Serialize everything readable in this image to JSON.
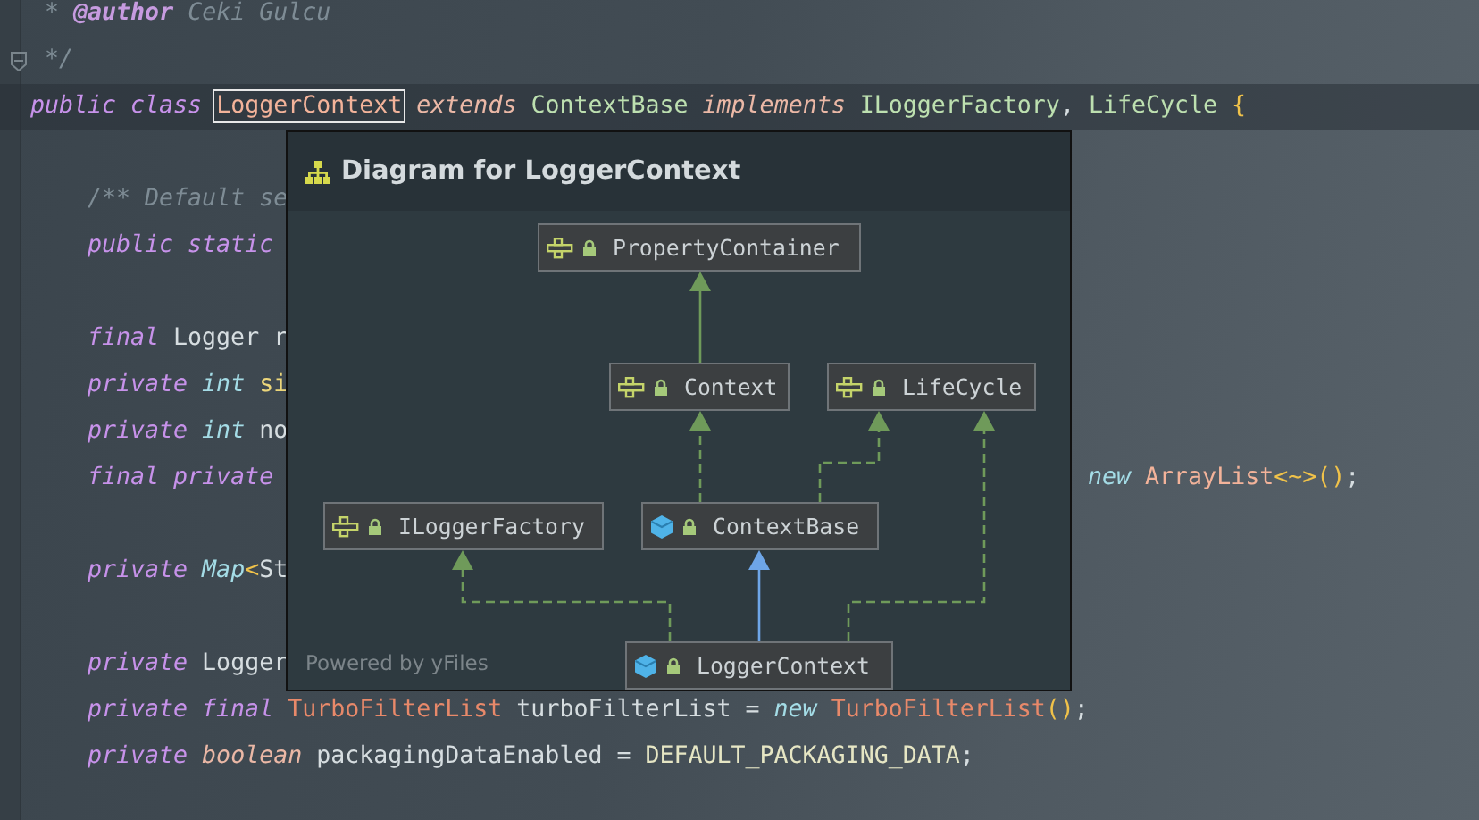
{
  "code": {
    "lines": [
      {
        "tokens": [
          {
            "kind": "comment",
            "text": " * "
          },
          {
            "kind": "doctag",
            "text": "@author"
          },
          {
            "kind": "comment",
            "text": " Ceki Gulcu"
          }
        ]
      },
      {
        "tokens": [
          {
            "kind": "comment",
            "text": " */"
          }
        ],
        "fold": true
      },
      {
        "current": true,
        "tokens": [
          {
            "kind": "keyword",
            "text": "public class "
          },
          {
            "kind": "class",
            "text": "LoggerContext",
            "highlighted": true
          },
          {
            "kind": "keyword2",
            "text": " extends "
          },
          {
            "kind": "type",
            "text": "ContextBase"
          },
          {
            "kind": "keyword2",
            "text": " implements "
          },
          {
            "kind": "type",
            "text": "ILoggerFactory"
          },
          {
            "kind": "plain",
            "text": ", "
          },
          {
            "kind": "type",
            "text": "LifeCycle"
          },
          {
            "kind": "brace",
            "text": " {"
          }
        ],
        "children": [
          {
            "blank": true
          },
          {
            "tokens": [
              {
                "kind": "comment",
                "text": "/** Default se"
              }
            ]
          },
          {
            "tokens": [
              {
                "kind": "keyword",
                "text": "public static"
              }
            ]
          },
          {
            "blank": true
          },
          {
            "tokens": [
              {
                "kind": "keyword",
                "text": "final"
              },
              {
                "kind": "plain",
                "text": " Logger r"
              }
            ]
          },
          {
            "tokens": [
              {
                "kind": "keyword",
                "text": "private"
              },
              {
                "kind": "keyword3",
                "text": " int"
              },
              {
                "kind": "field",
                "text": " si"
              }
            ]
          },
          {
            "tokens": [
              {
                "kind": "keyword",
                "text": "private"
              },
              {
                "kind": "keyword3",
                "text": " int"
              },
              {
                "kind": "plain",
                "text": " no"
              }
            ]
          },
          {
            "tokens": [
              {
                "kind": "keyword",
                "text": "final private"
              }
            ],
            "tail": [
              {
                "kind": "keyword3",
                "text": "new"
              },
              {
                "kind": "class",
                "text": " ArrayList"
              },
              {
                "kind": "brace",
                "text": "<~>()"
              },
              {
                "kind": "plain",
                "text": ";"
              }
            ]
          },
          {
            "blank": true
          },
          {
            "tokens": [
              {
                "kind": "keyword",
                "text": "private"
              },
              {
                "kind": "keyword3",
                "text": " Map"
              },
              {
                "kind": "brace",
                "text": "<"
              },
              {
                "kind": "plain",
                "text": "St"
              }
            ]
          },
          {
            "blank": true
          },
          {
            "tokens": [
              {
                "kind": "keyword",
                "text": "private"
              },
              {
                "kind": "plain",
                "text": " Logger"
              }
            ]
          },
          {
            "tokens": [
              {
                "kind": "keyword",
                "text": "private final"
              },
              {
                "kind": "class2",
                "text": " TurboFilterList"
              },
              {
                "kind": "plain",
                "text": " turboFilterList = "
              },
              {
                "kind": "keyword3",
                "text": "new"
              },
              {
                "kind": "class2",
                "text": " TurboFilterList"
              },
              {
                "kind": "brace",
                "text": "()"
              },
              {
                "kind": "plain",
                "text": ";"
              }
            ]
          },
          {
            "tokens": [
              {
                "kind": "keyword",
                "text": "private"
              },
              {
                "kind": "keyword2",
                "text": " boolean"
              },
              {
                "kind": "plain",
                "text": " packagingDataEnabled = "
              },
              {
                "kind": "const",
                "text": "DEFAULT_PACKAGING_DATA"
              },
              {
                "kind": "plain",
                "text": ";"
              }
            ]
          }
        ]
      }
    ]
  },
  "diagram_popup": {
    "title": "Diagram for LoggerContext",
    "nodes": [
      {
        "name": "PropertyContainer",
        "kind": "interface"
      },
      {
        "name": "Context",
        "kind": "interface"
      },
      {
        "name": "LifeCycle",
        "kind": "interface"
      },
      {
        "name": "ILoggerFactory",
        "kind": "interface"
      },
      {
        "name": "ContextBase",
        "kind": "class"
      },
      {
        "name": "LoggerContext",
        "kind": "class"
      }
    ],
    "edges": [
      {
        "kind": "interface_extends"
      },
      {
        "kind": "implements"
      },
      {
        "kind": "implements"
      },
      {
        "kind": "implements"
      },
      {
        "kind": "class_extends"
      },
      {
        "kind": "implements"
      }
    ],
    "footer": "Powered by yFiles"
  }
}
